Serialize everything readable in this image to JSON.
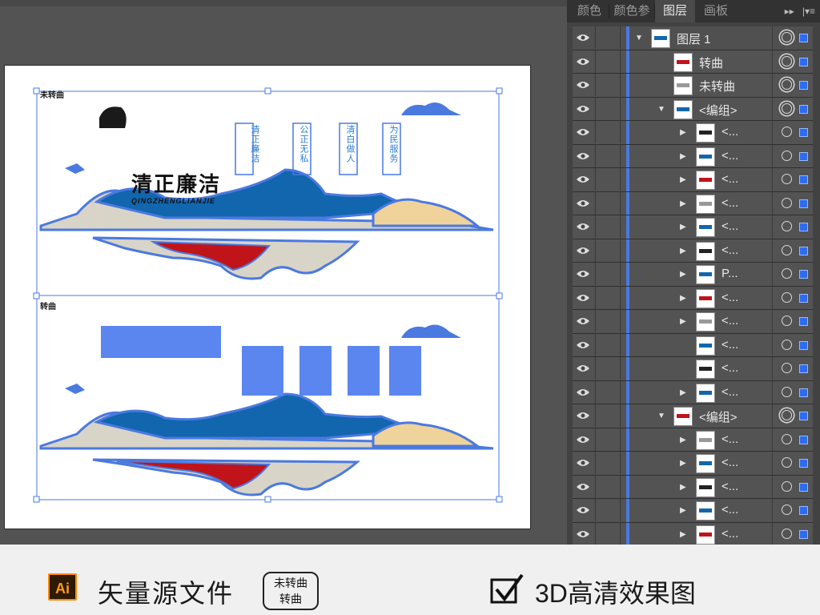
{
  "panel": {
    "tabs": [
      "颜色",
      "颜色参",
      "图层",
      "画板"
    ],
    "active_tab": "图层",
    "menu_icons": [
      "double-chevron-right-icon",
      "panel-menu-icon"
    ],
    "layers": [
      {
        "name": "图层 1",
        "indent": 0,
        "expanded": true,
        "double_target": true
      },
      {
        "name": "转曲",
        "indent": 1,
        "expanded": null,
        "double_target": true
      },
      {
        "name": "未转曲",
        "indent": 1,
        "expanded": null,
        "double_target": true
      },
      {
        "name": "<编组>",
        "indent": 1,
        "expanded": true,
        "double_target": true
      },
      {
        "name": "<...",
        "indent": 2,
        "expanded": false,
        "double_target": false
      },
      {
        "name": "<...",
        "indent": 2,
        "expanded": false,
        "double_target": false
      },
      {
        "name": "<...",
        "indent": 2,
        "expanded": false,
        "double_target": false
      },
      {
        "name": "<...",
        "indent": 2,
        "expanded": false,
        "double_target": false
      },
      {
        "name": "<...",
        "indent": 2,
        "expanded": false,
        "double_target": false
      },
      {
        "name": "<...",
        "indent": 2,
        "expanded": false,
        "double_target": false
      },
      {
        "name": "P...",
        "indent": 2,
        "expanded": false,
        "double_target": false
      },
      {
        "name": "<...",
        "indent": 2,
        "expanded": false,
        "double_target": false
      },
      {
        "name": "<...",
        "indent": 2,
        "expanded": false,
        "double_target": false
      },
      {
        "name": "<...",
        "indent": 2,
        "expanded": null,
        "double_target": false
      },
      {
        "name": "<...",
        "indent": 2,
        "expanded": null,
        "double_target": false
      },
      {
        "name": "<...",
        "indent": 2,
        "expanded": false,
        "double_target": false
      },
      {
        "name": "<编组>",
        "indent": 1,
        "expanded": true,
        "double_target": true
      },
      {
        "name": "<...",
        "indent": 2,
        "expanded": false,
        "double_target": false
      },
      {
        "name": "<...",
        "indent": 2,
        "expanded": false,
        "double_target": false
      },
      {
        "name": "<...",
        "indent": 2,
        "expanded": false,
        "double_target": false
      },
      {
        "name": "<...",
        "indent": 2,
        "expanded": false,
        "double_target": false
      },
      {
        "name": "<...",
        "indent": 2,
        "expanded": false,
        "double_target": false
      },
      {
        "name": "<...",
        "indent": 2,
        "expanded": false,
        "double_target": false
      }
    ]
  },
  "artboard": {
    "label_top": "未转曲",
    "label_bottom": "转曲",
    "title": "清正廉洁",
    "subtitle": "QINGZHENGLIANJIE",
    "vertical_texts": [
      "清正廉洁",
      "公正无私",
      "清白做人",
      "为民服务"
    ]
  },
  "footer": {
    "ai_icon_label": "Ai",
    "main_text": "矢量源文件",
    "box_line1": "未转曲",
    "box_line2": "转曲",
    "right_text": "3D高清效果图"
  },
  "colors": {
    "selection": "#4a79e0",
    "mountain_dark": "#1166ae",
    "mountain_grey": "#d8d4c8",
    "mountain_sand": "#f0d39a",
    "reflection_red": "#c0141a",
    "panel_bg": "#424242"
  }
}
